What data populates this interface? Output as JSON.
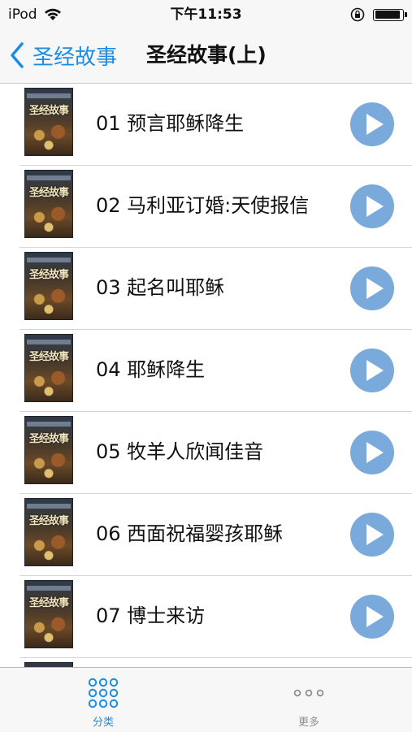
{
  "status_bar": {
    "carrier": "iPod",
    "time": "下午11:53",
    "icons": [
      "wifi-icon",
      "rotation-lock-icon",
      "battery-icon"
    ]
  },
  "nav": {
    "back_label": "圣经故事",
    "title": "圣经故事(上)"
  },
  "cover_text": "圣经故事",
  "episodes": [
    {
      "title": "01 预言耶稣降生"
    },
    {
      "title": "02 马利亚订婚:天使报信"
    },
    {
      "title": "03 起名叫耶稣"
    },
    {
      "title": "04 耶稣降生"
    },
    {
      "title": "05 牧羊人欣闻佳音"
    },
    {
      "title": "06 西面祝福婴孩耶稣"
    },
    {
      "title": "07 博士来访"
    },
    {
      "title": ""
    }
  ],
  "tabs": [
    {
      "label": "分类",
      "icon": "grid-icon",
      "selected": true
    },
    {
      "label": "更多",
      "icon": "more-icon",
      "selected": false
    }
  ],
  "colors": {
    "accent": "#1a8ce6",
    "play_button": "#7aa9dc",
    "inactive_tab": "#8e8e8e"
  }
}
